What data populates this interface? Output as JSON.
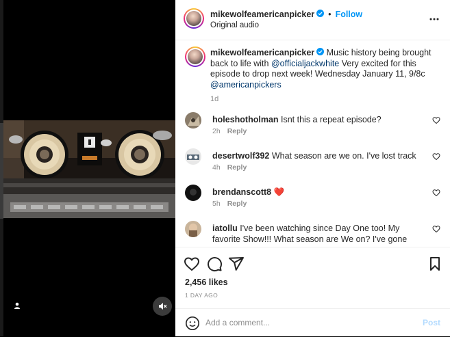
{
  "post": {
    "username": "mikewolfeamericanpicker",
    "follow_label": "Follow",
    "dot": "•",
    "audio_label": "Original audio",
    "caption": {
      "username": "mikewolfeamericanpicker",
      "text_before": " Music history being brought back to life with ",
      "mention1": "@officialjackwhite",
      "text_after": " Very excited for this episode to drop next week! Wednesday January 11, 9/8c ",
      "mention2": "@americanpickers",
      "time": "1d"
    },
    "comments": [
      {
        "username": "holeshotholman",
        "text": " Isnt this a repeat episode?",
        "time": "2h",
        "reply_label": "Reply"
      },
      {
        "username": "desertwolf392",
        "text": " What season are we on. I've lost track",
        "time": "4h",
        "reply_label": "Reply"
      },
      {
        "username": "brendanscott8",
        "text": " ❤️",
        "time": "5h",
        "reply_label": "Reply"
      },
      {
        "username": "iatollu",
        "text": " I've been watching since Day One too! My favorite Show!!! What season are We on? I've gone gray, but Mike Wolfe still looks like a young lad!!!",
        "time": "",
        "reply_label": ""
      }
    ],
    "likes": "2,456 likes",
    "date": "1 DAY AGO",
    "comment_placeholder": "Add a comment...",
    "post_label": "Post"
  },
  "colors": {
    "accent": "#0095f6",
    "post_disabled": "#b3dbff",
    "heart_red": "#ed4956",
    "muted": "#8e8e8e"
  },
  "icons": [
    "verified-badge-icon",
    "more-options-icon",
    "heart-icon",
    "comment-icon",
    "share-icon",
    "save-icon",
    "emoji-icon",
    "user-tag-icon",
    "mute-icon"
  ]
}
